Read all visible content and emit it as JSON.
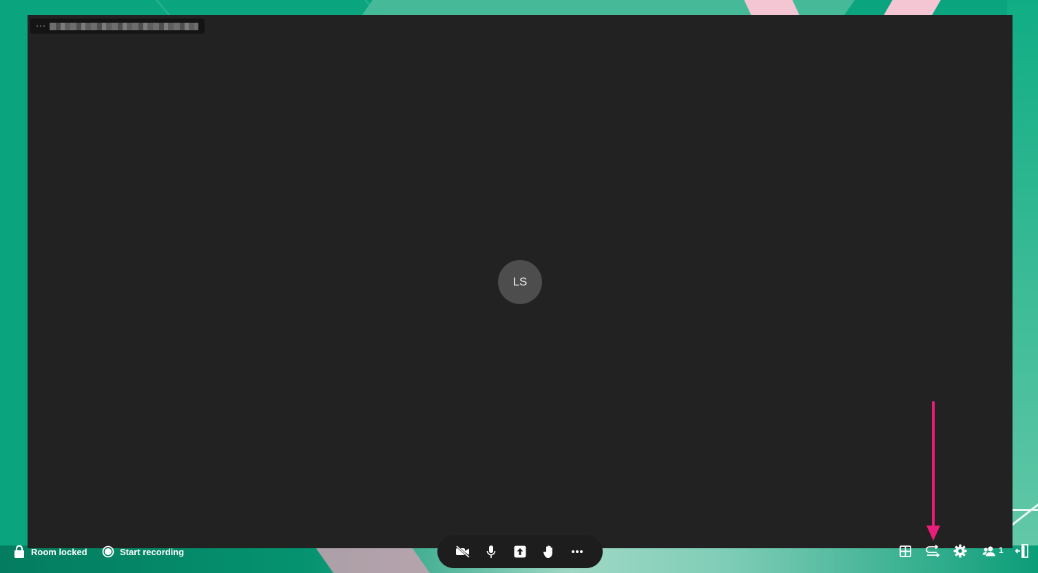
{
  "participant": {
    "initials": "LS",
    "name_tag_menu": "···"
  },
  "status": {
    "room_locked_label": "Room locked",
    "recording_label": "Start recording"
  },
  "toolbar": {
    "buttons": [
      "camera-off",
      "microphone",
      "share-screen",
      "raise-hand",
      "more-options"
    ]
  },
  "right_tools": {
    "participants_count": "1"
  },
  "colors": {
    "background": "#0aa57f",
    "stage": "#222222",
    "toolbar": "#1d1d1d",
    "annotation_arrow": "#e91e7b",
    "avatar": "#4d4d4d"
  }
}
